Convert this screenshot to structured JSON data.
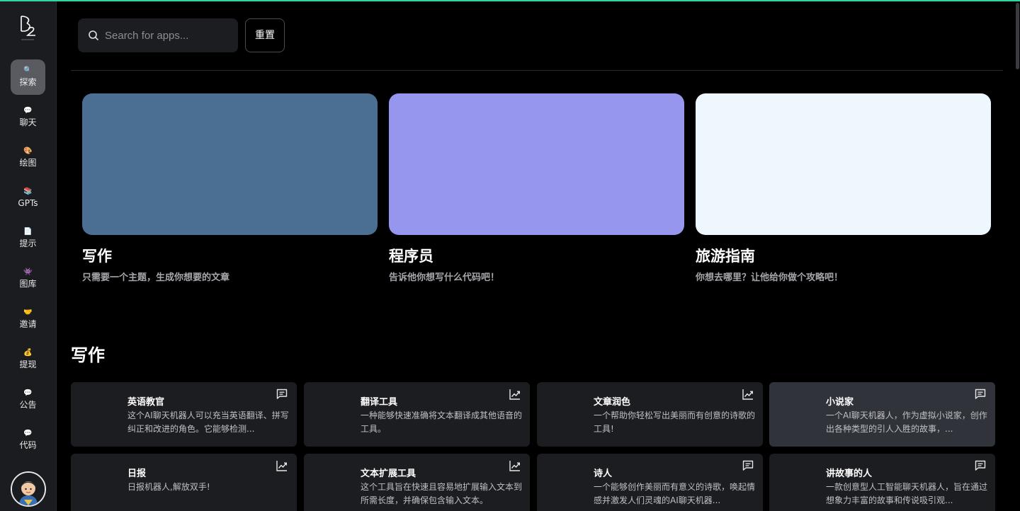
{
  "sidebar": {
    "items": [
      {
        "label": "探索",
        "icon": "magnifier-icon",
        "glyph": "🔍",
        "active": true
      },
      {
        "label": "聊天",
        "icon": "speech-bubble-icon",
        "glyph": "💬"
      },
      {
        "label": "绘图",
        "icon": "palette-icon",
        "glyph": "🎨"
      },
      {
        "label": "GPTs",
        "icon": "books-icon",
        "glyph": "📚"
      },
      {
        "label": "提示",
        "icon": "document-icon",
        "glyph": "📄"
      },
      {
        "label": "图库",
        "icon": "alien-monster-icon",
        "glyph": "👾"
      },
      {
        "label": "邀请",
        "icon": "handshake-icon",
        "glyph": "🤝"
      },
      {
        "label": "提现",
        "icon": "money-bag-icon",
        "glyph": "💰"
      },
      {
        "label": "公告",
        "icon": "speech-bubble-icon",
        "glyph": "💬"
      },
      {
        "label": "代码",
        "icon": "speech-bubble-icon",
        "glyph": "💬"
      }
    ]
  },
  "search": {
    "placeholder": "Search for apps..."
  },
  "reset_label": "重置",
  "featured": [
    {
      "title": "写作",
      "desc": "只需要一个主题，生成你想要的文章",
      "color": "#4a6f93"
    },
    {
      "title": "程序员",
      "desc": "告诉他你想写什么代码吧！",
      "color": "#9796ef"
    },
    {
      "title": "旅游指南",
      "desc": "你想去哪里？让他给你做个攻略吧！",
      "color": "#eef6fe"
    }
  ],
  "section_title": "写作",
  "apps": [
    {
      "title": "英语教官",
      "desc": "这个AI聊天机器人可以充当英语翻译、拼写纠正和改进的角色。它能够检测...",
      "icon": "chat-icon"
    },
    {
      "title": "翻译工具",
      "desc": "一种能够快速准确将文本翻译成其他语音的工具。",
      "icon": "chart-icon"
    },
    {
      "title": "文章润色",
      "desc": "一个帮助你轻松写出美丽而有创意的诗歌的工具!",
      "icon": "chart-icon"
    },
    {
      "title": "小说家",
      "desc": "一个AI聊天机器人，作为虚拟小说家，创作出各种类型的引人入胜的故事，...",
      "icon": "chat-icon",
      "highlight": true
    },
    {
      "title": "日报",
      "desc": "日报机器人,解放双手!",
      "icon": "chart-icon"
    },
    {
      "title": "文本扩展工具",
      "desc": "这个工具旨在快速且容易地扩展输入文本到所需长度，并确保包含输入文本。",
      "icon": "chart-icon"
    },
    {
      "title": "诗人",
      "desc": "一个能够创作美丽而有意义的诗歌，唤起情感并激发人们灵魂的AI聊天机器...",
      "icon": "chat-icon"
    },
    {
      "title": "讲故事的人",
      "desc": "一款创意型人工智能聊天机器人，旨在通过想象力丰富的故事和传说吸引观...",
      "icon": "chat-icon"
    }
  ],
  "colors": {
    "accent": "#34d3a2",
    "card_bg": "#1c1d21",
    "card_highlight": "#30343a"
  }
}
